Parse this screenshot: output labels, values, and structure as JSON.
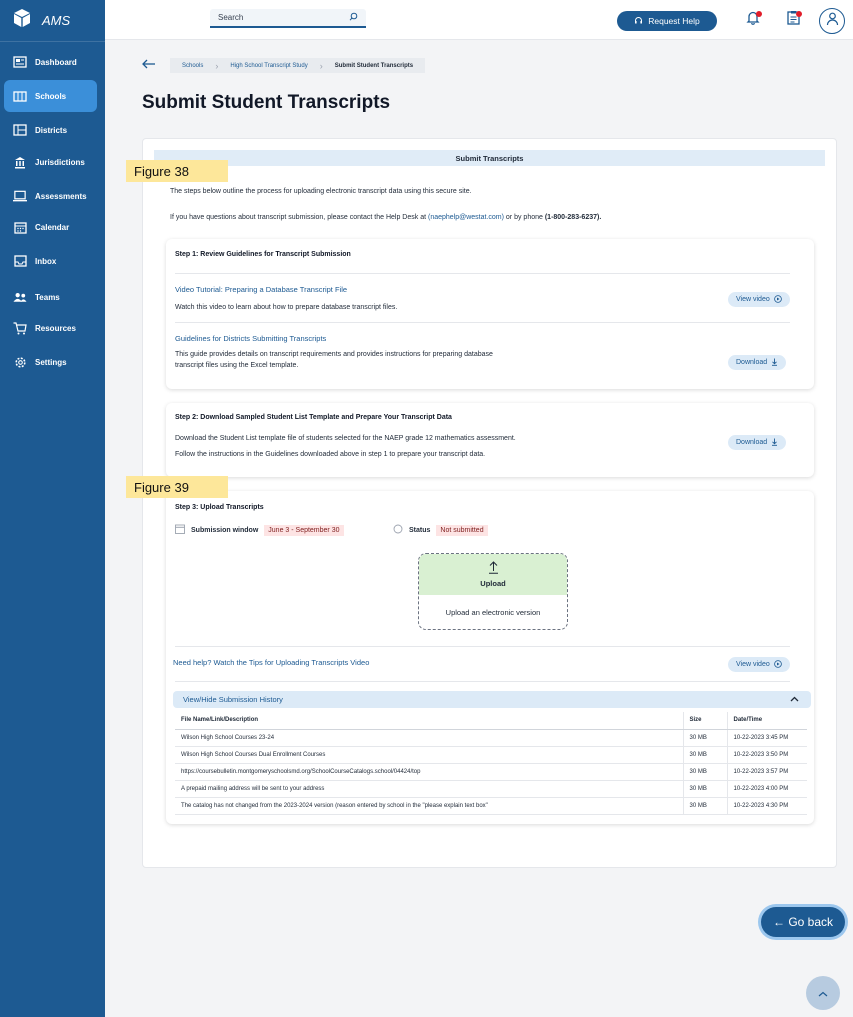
{
  "app": {
    "name": "AMS"
  },
  "sidebar": {
    "items": [
      {
        "label": "Dashboard",
        "icon": "dashboard-icon"
      },
      {
        "label": "Schools",
        "icon": "schools-icon",
        "active": true
      },
      {
        "label": "Districts",
        "icon": "districts-icon"
      },
      {
        "label": "Jurisdictions",
        "icon": "jurisdictions-icon"
      },
      {
        "label": "Assessments",
        "icon": "assessments-icon"
      },
      {
        "label": "Calendar",
        "icon": "calendar-icon"
      },
      {
        "label": "Inbox",
        "icon": "inbox-icon"
      },
      {
        "label": "Teams",
        "icon": "teams-icon"
      },
      {
        "label": "Resources",
        "icon": "resources-icon"
      },
      {
        "label": "Settings",
        "icon": "settings-icon"
      }
    ]
  },
  "topbar": {
    "search_label": "Search",
    "request_help": "Request Help"
  },
  "breadcrumb": [
    "Schools",
    "High School Transcript Study",
    "Submit Student Transcripts"
  ],
  "page": {
    "title": "Submit Student Transcripts",
    "section_header": "Submit Transcripts",
    "figure_38": "Figure 38",
    "figure_39": "Figure 39",
    "intro_1": "The steps below outline the process for uploading electronic transcript data using this secure site.",
    "intro_2_prefix": "If you have questions about transcript submission, please contact the Help Desk at ",
    "intro_2_email": "(naephelp@westat.com)",
    "intro_2_mid": " or by phone ",
    "intro_2_phone": "(1-800-283-6237).",
    "go_back": "← Go back"
  },
  "step1": {
    "title": "Step 1: Review Guidelines for Transcript Submission",
    "video_link": "Video Tutorial: Preparing a Database Transcript File",
    "video_desc": "Watch this video to learn about how to prepare database transcript files.",
    "video_btn": "View video",
    "guide_link": "Guidelines for Districts Submitting Transcripts",
    "guide_desc_1": "This guide provides details on transcript requirements and provides instructions for preparing database",
    "guide_desc_2": "transcript files using the Excel template.",
    "guide_btn": "Download"
  },
  "step2": {
    "title": "Step 2: Download Sampled Student List Template and Prepare Your Transcript Data",
    "desc_1": "Download the Student List template file of students selected for the NAEP grade 12 mathematics assessment.",
    "desc_2": "Follow the instructions in the Guidelines downloaded above in step 1 to prepare your transcript data.",
    "btn": "Download"
  },
  "step3": {
    "title": "Step 3: Upload Transcripts",
    "window_label": "Submission window",
    "window_value": "June 3 - September 30",
    "status_label": "Status",
    "status_value": "Not submitted",
    "upload_title": "Upload",
    "upload_desc": "Upload an electronic version",
    "help_link": "Need help? Watch the Tips for Uploading Transcripts Video",
    "help_btn": "View video",
    "history_toggle": "View/Hide Submission History",
    "table": {
      "headers": [
        "File Name/Link/Description",
        "Size",
        "Date/Time"
      ],
      "rows": [
        [
          "Wilson High School Courses 23-24",
          "30 MB",
          "10-22-2023 3:45 PM"
        ],
        [
          "Wilson High School Courses Dual Enrollment Courses",
          "30 MB",
          "10-22-2023 3:50 PM"
        ],
        [
          "https://coursebulletin.montgomeryschoolsmd.org/SchoolCourseCatalogs.school/04424/top",
          "30 MB",
          "10-22-2023 3:57 PM"
        ],
        [
          "A prepaid mailing address will be sent to your address",
          "30 MB",
          "10-22-2023 4:00 PM"
        ],
        [
          "The catalog has not changed from the 2023-2024 version (reason entered by school in the \"please explain text box\"",
          "30 MB",
          "10-22-2023 4:30 PM"
        ]
      ]
    }
  },
  "colors": {
    "primary": "#1d5a92",
    "active_nav": "#3b8fd9",
    "highlight": "#fde79a",
    "upload_bg": "#d9f0d2"
  }
}
